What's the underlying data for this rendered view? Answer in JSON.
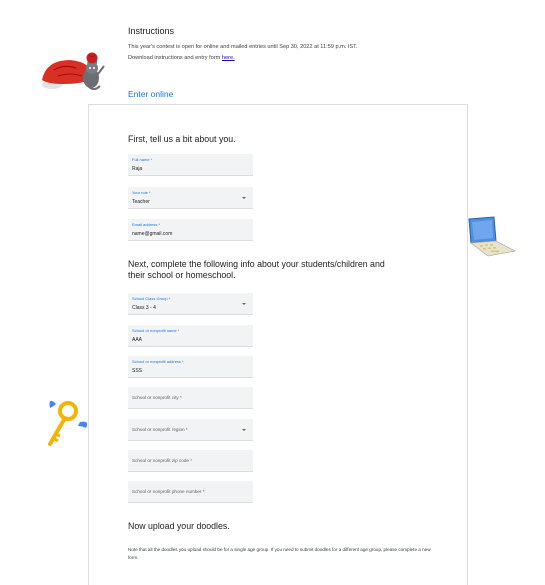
{
  "instructions": {
    "title": "Instructions",
    "line1": "This year's contest is open for online and mailed entries until Sep 30, 2022 at 11:59 p.m. IST.",
    "line2_prefix": "Download instructions and entry form ",
    "line2_link": "here."
  },
  "enter_online": "Enter online",
  "section1": {
    "heading": "First, tell us a bit about you."
  },
  "fields_about": [
    {
      "label": "Full name *",
      "value": "Raja"
    },
    {
      "label": "Your role *",
      "value": "Teacher"
    },
    {
      "label": "Email address *",
      "value": "name@gmail.com"
    }
  ],
  "section2": {
    "heading": "Next, complete the following info about your students/children and their school or homeschool."
  },
  "fields_school": [
    {
      "label": "School Class Group *",
      "value": "Class 3 - 4"
    },
    {
      "label": "School or nonprofit name *",
      "value": "AAA"
    },
    {
      "label": "School or nonprofit address *",
      "value": "SSS"
    },
    {
      "placeholder": "School or nonprofit city *"
    },
    {
      "placeholder": "School or nonprofit region *"
    },
    {
      "placeholder": "School or nonprofit zip code *"
    },
    {
      "placeholder": "School or nonprofit phone number *"
    }
  ],
  "section3": {
    "heading": "Now upload your doodles.",
    "note": "Note that all the doodles you upload should be for a single age group. If you need to submit doodles for a different age group, please complete a new form."
  },
  "decorations": {
    "left_top": "cat-with-red-ball-doodle",
    "right": "laptop-doodle",
    "left_bottom": "winged-key-doodle"
  }
}
